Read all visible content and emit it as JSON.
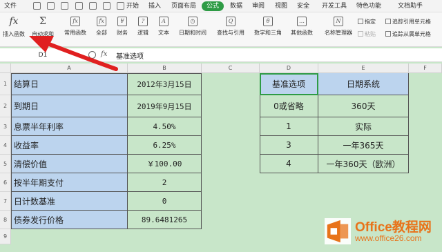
{
  "tabbar": {
    "file_label": "文件",
    "tabs": [
      {
        "label": "开始"
      },
      {
        "label": "插入"
      },
      {
        "label": "页面布局"
      },
      {
        "label": "公式"
      },
      {
        "label": "数据"
      },
      {
        "label": "审阅"
      },
      {
        "label": "视图"
      },
      {
        "label": "安全"
      },
      {
        "label": "开发工具"
      },
      {
        "label": "特色功能"
      },
      {
        "label": "文档助手"
      }
    ],
    "active_tab": "公式"
  },
  "ribbon": {
    "insert_function": {
      "label": "插入函数",
      "icon": "fx-icon"
    },
    "autosum": {
      "label": "自动求和",
      "icon": "sigma-icon"
    },
    "common_functions": {
      "label": "常用函数",
      "icon": "function-icon"
    },
    "all": {
      "label": "全部",
      "icon": "function-icon"
    },
    "finance": {
      "label": "财务",
      "icon": "finance-icon"
    },
    "logic": {
      "label": "逻辑",
      "icon": "logic-icon"
    },
    "text": {
      "label": "文本",
      "icon": "text-icon"
    },
    "datetime": {
      "label": "日期和时间",
      "icon": "calendar-icon"
    },
    "lookup": {
      "label": "查找与引用",
      "icon": "search-icon"
    },
    "math": {
      "label": "数学和三角",
      "icon": "math-icon"
    },
    "other": {
      "label": "其他函数",
      "icon": "more-icon"
    },
    "name_manager": {
      "label": "名称管理器",
      "icon": "name-manager-icon"
    },
    "specify": {
      "label": "指定"
    },
    "paste": {
      "label": "粘贴"
    },
    "trace_precedents": {
      "label": "追踪引用单元格"
    },
    "trace_dependents": {
      "label": "追踪从属单元格"
    }
  },
  "formula_bar": {
    "name_box": "D1",
    "fx": "fx",
    "content": "基准选项"
  },
  "columns": [
    "A",
    "B",
    "C",
    "D",
    "E",
    "F"
  ],
  "rows": [
    "1",
    "2",
    "3",
    "4",
    "5",
    "6",
    "7",
    "8",
    "9"
  ],
  "table_left": [
    {
      "label": "结算日",
      "value": "2012年3月15日"
    },
    {
      "label": "到期日",
      "value": "2019年9月15日"
    },
    {
      "label": "息票半年利率",
      "value": "4.50%"
    },
    {
      "label": "收益率",
      "value": "6.25%"
    },
    {
      "label": "清偿价值",
      "value": "￥100.00"
    },
    {
      "label": "按半年期支付",
      "value": "2"
    },
    {
      "label": "日计数基准",
      "value": "0"
    },
    {
      "label": "债券发行价格",
      "value": "89.6481265"
    }
  ],
  "table_right": {
    "headers": [
      "基准选项",
      "日期系统"
    ],
    "rows": [
      [
        "0或省略",
        "360天"
      ],
      [
        "1",
        "实际"
      ],
      [
        "3",
        "一年365天"
      ],
      [
        "4",
        "一年360天（欧洲）"
      ]
    ]
  },
  "watermark": {
    "title": "Office教程网",
    "url": "www.office26.com"
  },
  "colors": {
    "accent": "#2e9b45",
    "header_fill": "#bcd4ee",
    "sheet_bg": "#c8e6c9",
    "arrow": "#e02020",
    "watermark": "#e8731a"
  }
}
